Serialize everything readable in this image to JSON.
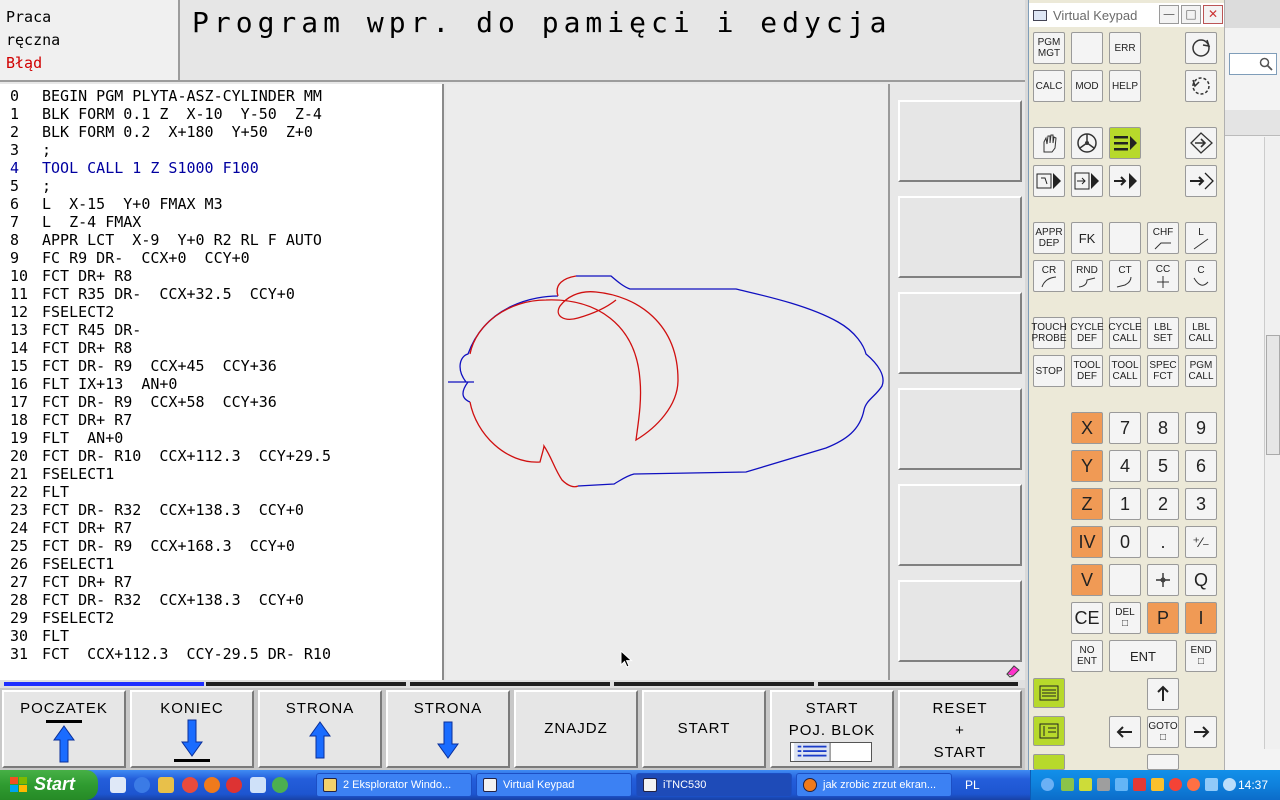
{
  "mode": {
    "line1": "Praca",
    "line2": "ręczna",
    "error": "Błąd"
  },
  "title": "Program wpr. do pamięci i edycja",
  "program": {
    "active_line": 4,
    "lines": [
      {
        "n": "0",
        "text": "BEGIN PGM PLYTA-ASZ-CYLINDER MM"
      },
      {
        "n": "1",
        "text": "BLK FORM 0.1 Z  X-10  Y-50  Z-4"
      },
      {
        "n": "2",
        "text": "BLK FORM 0.2  X+180  Y+50  Z+0"
      },
      {
        "n": "3",
        "text": ";"
      },
      {
        "n": "4",
        "text": "TOOL CALL 1 Z S1000 F100"
      },
      {
        "n": "5",
        "text": ";"
      },
      {
        "n": "6",
        "text": "L  X-15  Y+0 FMAX M3"
      },
      {
        "n": "7",
        "text": "L  Z-4 FMAX"
      },
      {
        "n": "8",
        "text": "APPR LCT  X-9  Y+0 R2 RL F AUTO"
      },
      {
        "n": "9",
        "text": "FC R9 DR-  CCX+0  CCY+0"
      },
      {
        "n": "10",
        "text": "FCT DR+ R8"
      },
      {
        "n": "11",
        "text": "FCT R35 DR-  CCX+32.5  CCY+0"
      },
      {
        "n": "12",
        "text": "FSELECT2"
      },
      {
        "n": "13",
        "text": "FCT R45 DR-"
      },
      {
        "n": "14",
        "text": "FCT DR+ R8"
      },
      {
        "n": "15",
        "text": "FCT DR- R9  CCX+45  CCY+36"
      },
      {
        "n": "16",
        "text": "FLT IX+13  AN+0"
      },
      {
        "n": "17",
        "text": "FCT DR- R9  CCX+58  CCY+36"
      },
      {
        "n": "18",
        "text": "FCT DR+ R7"
      },
      {
        "n": "19",
        "text": "FLT  AN+0"
      },
      {
        "n": "20",
        "text": "FCT DR- R10  CCX+112.3  CCY+29.5"
      },
      {
        "n": "21",
        "text": "FSELECT1"
      },
      {
        "n": "22",
        "text": "FLT"
      },
      {
        "n": "23",
        "text": "FCT DR- R32  CCX+138.3  CCY+0"
      },
      {
        "n": "24",
        "text": "FCT DR+ R7"
      },
      {
        "n": "25",
        "text": "FCT DR- R9  CCX+168.3  CCY+0"
      },
      {
        "n": "26",
        "text": "FSELECT1"
      },
      {
        "n": "27",
        "text": "FCT DR+ R7"
      },
      {
        "n": "28",
        "text": "FCT DR- R32  CCX+138.3  CCY+0"
      },
      {
        "n": "29",
        "text": "FSELECT2"
      },
      {
        "n": "30",
        "text": "FLT"
      },
      {
        "n": "31",
        "text": "FCT  CCX+112.3  CCY-29.5 DR- R10"
      }
    ]
  },
  "colors": {
    "contour": "#1010c0",
    "contour_alt": "#d01010",
    "active_line": "#0000a0",
    "error": "#d00000",
    "progress": "#1e2fff"
  },
  "softkeys": {
    "start_label": "POCZATEK",
    "end_label": "KONIEC",
    "page_up_label": "STRONA",
    "page_down_label": "STRONA",
    "find_label": "ZNAJDZ",
    "start_run_label": "START",
    "start_block_line1": "START",
    "start_block_line2": "POJ. BLOK",
    "reset_line1": "RESET",
    "reset_line2": "+",
    "reset_line3": "START"
  },
  "keypad": {
    "title": "Virtual Keypad",
    "keys": {
      "pgm_mgt_1": "PGM",
      "pgm_mgt_2": "MGT",
      "err": "ERR",
      "calc": "CALC",
      "mod": "MOD",
      "help": "HELP",
      "appr_1": "APPR",
      "appr_2": "DEP",
      "fk": "FK",
      "chf": "CHF",
      "l": "L",
      "cr": "CR",
      "rnd": "RND",
      "ct": "CT",
      "cc": "CC",
      "c": "C",
      "touch_1": "TOUCH",
      "touch_2": "PROBE",
      "cycle_def_1": "CYCLE",
      "cycle_def_2": "DEF",
      "cycle_call_1": "CYCLE",
      "cycle_call_2": "CALL",
      "lbl_set_1": "LBL",
      "lbl_set_2": "SET",
      "lbl_call_1": "LBL",
      "lbl_call_2": "CALL",
      "stop": "STOP",
      "tool_def_1": "TOOL",
      "tool_def_2": "DEF",
      "tool_call_1": "TOOL",
      "tool_call_2": "CALL",
      "spec_1": "SPEC",
      "spec_2": "FCT",
      "pgm_call_1": "PGM",
      "pgm_call_2": "CALL",
      "x": "X",
      "y": "Y",
      "z": "Z",
      "iv": "IV",
      "v": "V",
      "d7": "7",
      "d8": "8",
      "d9": "9",
      "d4": "4",
      "d5": "5",
      "d6": "6",
      "d1": "1",
      "d2": "2",
      "d3": "3",
      "d0": "0",
      "dot": ".",
      "sign": "⁺⁄₋",
      "q": "Q",
      "ce": "CE",
      "del": "DEL",
      "p": "P",
      "i": "I",
      "no_ent_1": "NO",
      "no_ent_2": "ENT",
      "ent": "ENT",
      "end": "END",
      "goto": "GOTO"
    }
  },
  "taskbar": {
    "start": "Start",
    "tasks": [
      "2 Eksplorator Windo...",
      "Virtual Keypad",
      "iTNC530",
      "jak zrobic zrzut ekran..."
    ],
    "lang": "PL",
    "clock": "14:37"
  }
}
